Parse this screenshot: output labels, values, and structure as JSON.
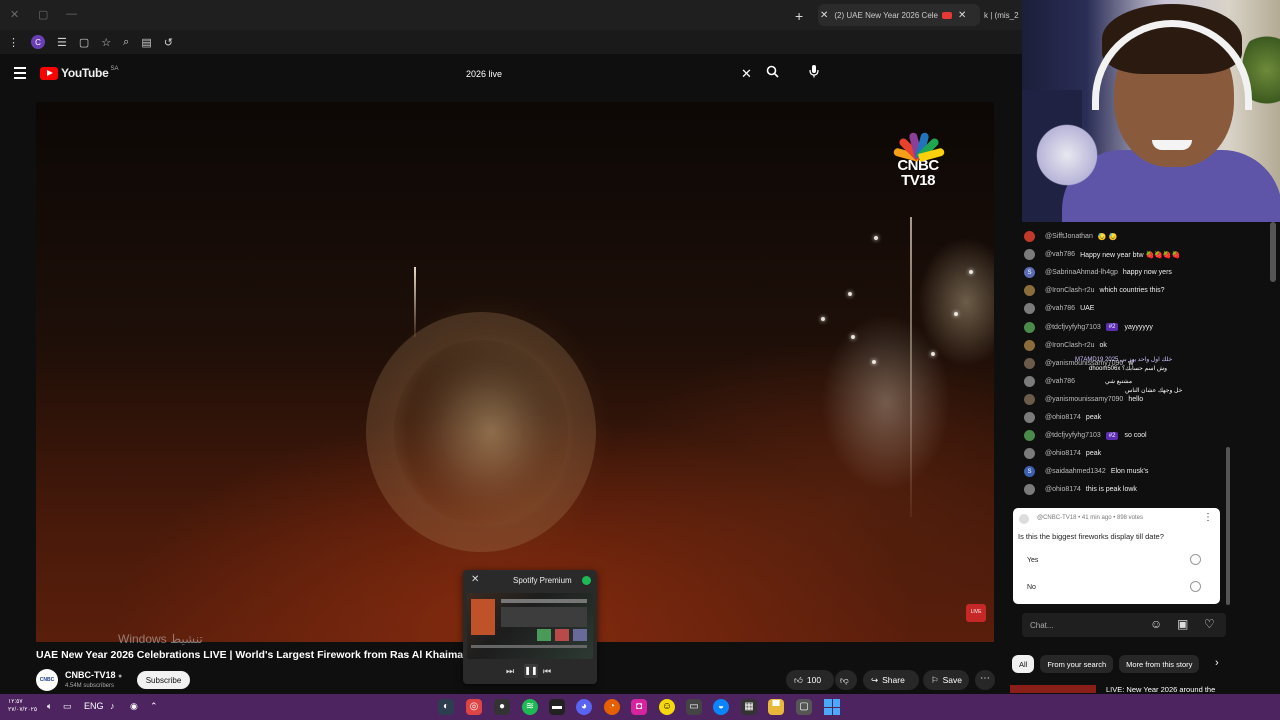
{
  "browser": {
    "tabs": [
      {
        "label": "(2) UAE New Year 2026 Cele",
        "active": true,
        "recording": true
      },
      {
        "label": "k | (mis_2",
        "active": false
      }
    ],
    "profile_initial": "C"
  },
  "youtube": {
    "logo_text": "YouTube",
    "country_code": "SA",
    "search": {
      "value": "2026 live"
    }
  },
  "video": {
    "channel_logo_text": "CNBC\nTV18",
    "watermark": "Windows تنشيط",
    "title": "UAE New Year 2026 Celebrations LIVE | World's Largest Firework from Ras Al Khaimah",
    "channel": {
      "name": "CNBC-TV18",
      "subscribers": "4.54M subscribers",
      "avatar_text": "CNBC"
    },
    "subscribe_label": "Subscribe",
    "likes": "100",
    "share_label": "Share",
    "save_label": "Save"
  },
  "spotify": {
    "title": "Spotify Premium"
  },
  "chat": {
    "messages": [
      {
        "user": "@SifftJonathan",
        "msg": "😓 😓",
        "color": "#c0392b"
      },
      {
        "user": "@vah786",
        "msg": "Happy new year btw 🍓🍓🍓🍓",
        "color": "#7b7b7b"
      },
      {
        "user": "@SabrinaAhmad-lh4gp",
        "msg": "happy now yers",
        "color": "#5b6bb5",
        "initial": "S"
      },
      {
        "user": "@IronClash-r2u",
        "msg": "which countries this?",
        "color": "#8a6d3b"
      },
      {
        "user": "@vah786",
        "msg": "UAE",
        "color": "#7b7b7b"
      },
      {
        "user": "@tdcfjvyfyhg7103",
        "msg": "yayyyyyy",
        "color": "#4a8a4a",
        "badge": "#2"
      },
      {
        "user": "@IronClash-r2u",
        "msg": "ok",
        "color": "#8a6d3b"
      },
      {
        "user": "@yanismounissamy7090",
        "msg": "w",
        "color": "#6b5b4b"
      },
      {
        "user": "@vah786",
        "msg": "",
        "color": "#7b7b7b"
      },
      {
        "user": "@yanismounissamy7090",
        "msg": "hello",
        "color": "#6b5b4b"
      },
      {
        "user": "@ohio8174",
        "msg": "peak",
        "color": "#7b7b7b"
      },
      {
        "user": "@tdcfjvyfyhg7103",
        "msg": "so cool",
        "color": "#4a8a4a",
        "badge": "#2"
      },
      {
        "user": "@ohio8174",
        "msg": "peak",
        "color": "#7b7b7b"
      },
      {
        "user": "@saidaahmed1342",
        "msg": "Elon musk's",
        "color": "#3c5fb0",
        "initial": "S"
      },
      {
        "user": "@ohio8174",
        "msg": "this is peak lowk",
        "color": "#7b7b7b"
      }
    ],
    "overlay_lines": [
      "M7AMD19 خلك اول واحد يهز بي 2025",
      "dhoom506x وش اسم حسابك؟",
      "مشتبع شي",
      "خل وجهك عشان الناس"
    ],
    "poll": {
      "meta": "@CNBC-TV18 • 41 min ago • 898 votes",
      "question": "Is this the biggest fireworks display till date?",
      "options": [
        "Yes",
        "No"
      ]
    },
    "input_placeholder": "Chat...",
    "chips": [
      "All",
      "From your search",
      "More from this story"
    ],
    "next_video": "LIVE: New Year 2026 around the"
  },
  "taskbar": {
    "time": "١٢:٥٧",
    "date": "٢٧/٠٧/٢٠٢٥",
    "language": "ENG"
  }
}
